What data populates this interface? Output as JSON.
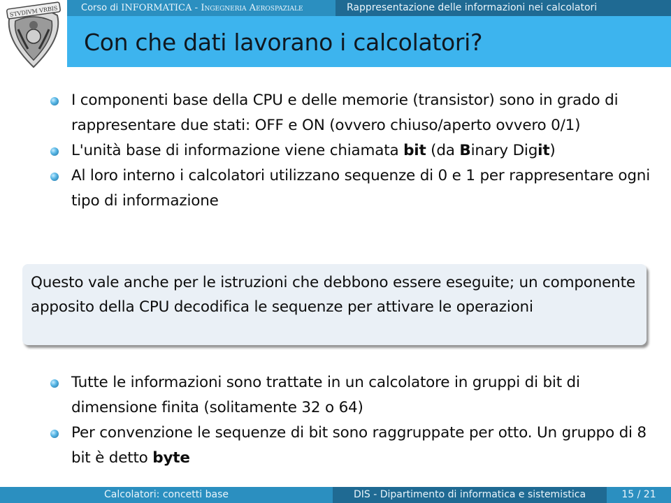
{
  "header": {
    "course_prefix": "Corso di ",
    "course_name": "INFORMATICA",
    "course_sep": " - ",
    "course_faculty": "Ingegneria Aerospaziale",
    "section": "Rappresentazione delle informazioni nei calcolatori",
    "logo_label": "STVDIVM VRBIS"
  },
  "slide": {
    "title": "Con che dati lavorano i calcolatori?",
    "bullets_top": [
      {
        "text": "I componenti base della CPU e delle memorie (transistor) sono in grado di rappresentare due stati: OFF e ON (ovvero chiuso/aperto ovvero 0/1)"
      },
      {
        "pre": "L'unità base di informazione viene chiamata ",
        "bold1": "bit",
        "mid1": " (da ",
        "bold2": "B",
        "mid2": "inary Dig",
        "bold3": "it",
        "post": ")"
      },
      {
        "text": "Al loro interno i calcolatori utilizzano sequenze di 0 e 1 per rappresentare ogni tipo di informazione"
      }
    ],
    "block_text": "Questo vale anche per le istruzioni che debbono essere eseguite; un componente apposito della CPU decodifica le sequenze per attivare le operazioni",
    "bullets_bottom": [
      {
        "text": "Tutte le informazioni sono trattate in un calcolatore in gruppi di bit di dimensione finita (solitamente 32 o 64)"
      },
      {
        "pre": "Per convenzione le sequenze di bit sono raggruppate per otto. Un gruppo di 8 bit è detto ",
        "bold": "byte"
      }
    ]
  },
  "footer": {
    "topic": "Calcolatori: concetti base",
    "department": "DIS - Dipartimento di informatica e sistemistica",
    "page": "15 / 21"
  },
  "colors": {
    "title_bar": "#3db4ee",
    "header_left": "#2b8fc0",
    "header_right": "#1f6a93",
    "block_bg": "#eaf0f6"
  }
}
